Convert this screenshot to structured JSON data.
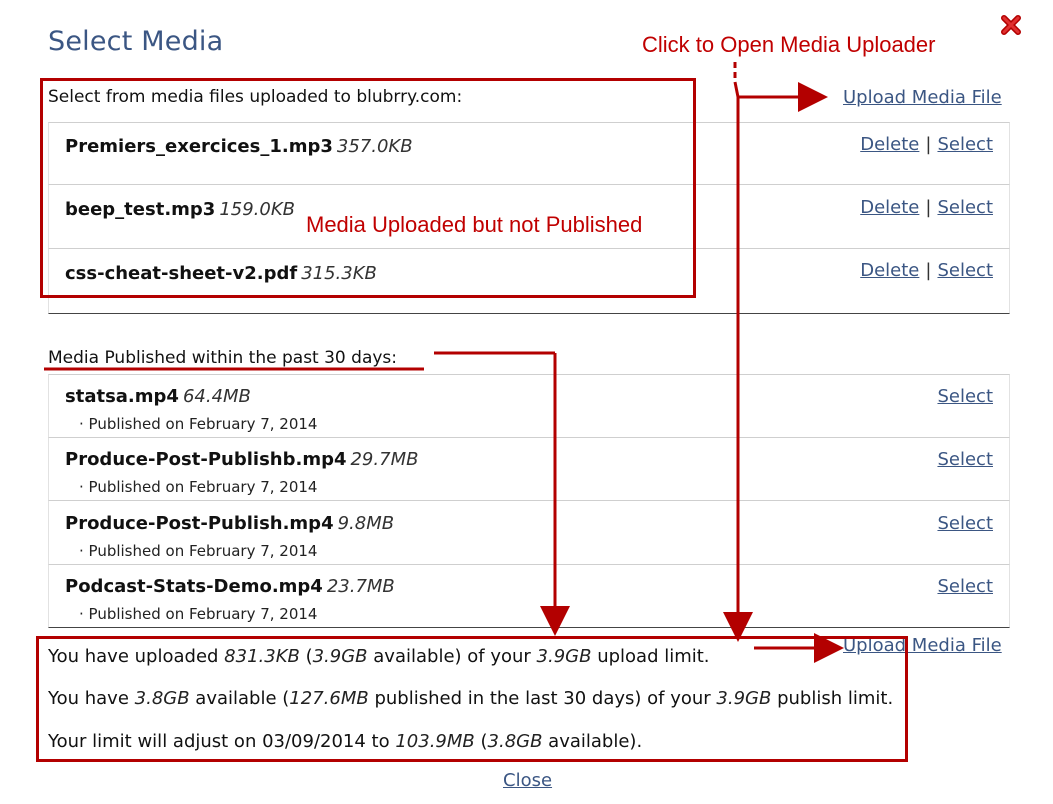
{
  "dialog": {
    "title": "Select Media",
    "close_label": "Close"
  },
  "annotations": {
    "open_uploader": "Click to Open Media Uploader",
    "unpublished": "Media Uploaded but not Published"
  },
  "uploaded": {
    "label": "Select from media files uploaded to blubrry.com:",
    "upload_link": "Upload Media File",
    "files": [
      {
        "name": "Premiers_exercices_1.mp3",
        "size": "357.0KB"
      },
      {
        "name": "beep_test.mp3",
        "size": "159.0KB"
      },
      {
        "name": "css-cheat-sheet-v2.pdf",
        "size": "315.3KB"
      }
    ],
    "delete_label": "Delete",
    "select_label": "Select",
    "separator": "|"
  },
  "published": {
    "label": "Media Published within the past 30 days:",
    "select_label": "Select",
    "files": [
      {
        "name": "statsa.mp4",
        "size": "64.4MB",
        "date": "· Published on February 7, 2014"
      },
      {
        "name": "Produce-Post-Publishb.mp4",
        "size": "29.7MB",
        "date": "· Published on February 7, 2014"
      },
      {
        "name": "Produce-Post-Publish.mp4",
        "size": "9.8MB",
        "date": "· Published on February 7, 2014"
      },
      {
        "name": "Podcast-Stats-Demo.mp4",
        "size": "23.7MB",
        "date": "· Published on February 7, 2014"
      }
    ],
    "upload_link": "Upload Media File"
  },
  "limits": {
    "line1": {
      "t1": "You have uploaded ",
      "v1": "831.3KB",
      "t2": " (",
      "v2": "3.9GB",
      "t3": " available) of your ",
      "v3": "3.9GB",
      "t4": " upload limit."
    },
    "line2": {
      "t1": "You have ",
      "v1": "3.8GB",
      "t2": " available (",
      "v2": "127.6MB",
      "t3": " published in the last 30 days) of your ",
      "v3": "3.9GB",
      "t4": " publish limit."
    },
    "line3": {
      "t1": "Your limit will adjust on 03/09/2014 to ",
      "v1": "103.9MB",
      "t2": " (",
      "v2": "3.8GB",
      "t3": " available)."
    }
  },
  "colors": {
    "annotation_red": "#c00000",
    "link_blue": "#3b5683"
  }
}
